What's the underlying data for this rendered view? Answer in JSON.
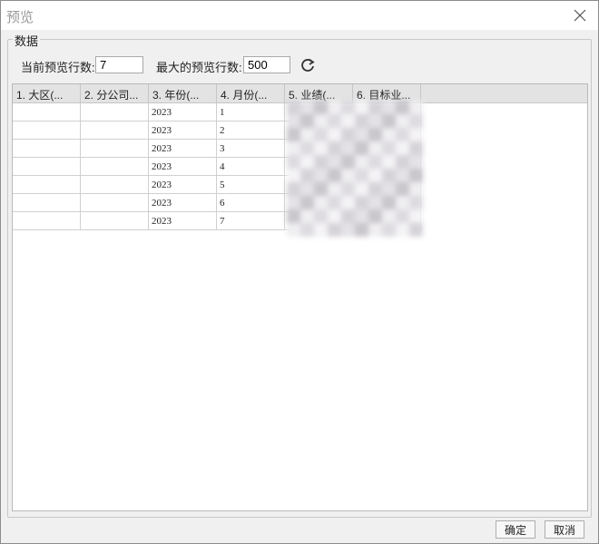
{
  "window": {
    "title": "预览"
  },
  "group": {
    "legend": "数据"
  },
  "controls": {
    "current_rows_label": "当前预览行数:",
    "current_rows_value": "7",
    "max_rows_label": "最大的预览行数:",
    "max_rows_value": "500"
  },
  "table": {
    "columns": [
      "1. 大区(...",
      "2. 分公司...",
      "3. 年份(...",
      "4. 月份(...",
      "5. 业绩(...",
      "6. 目标业..."
    ],
    "rows": [
      [
        "",
        "",
        "2023",
        "1",
        "",
        ""
      ],
      [
        "",
        "",
        "2023",
        "2",
        "",
        ""
      ],
      [
        "",
        "",
        "2023",
        "3",
        "",
        ""
      ],
      [
        "",
        "",
        "2023",
        "4",
        "",
        ""
      ],
      [
        "",
        "",
        "2023",
        "5",
        "",
        ""
      ],
      [
        "",
        "",
        "2023",
        "6",
        "",
        ""
      ],
      [
        "",
        "",
        "2023",
        "7",
        "",
        ""
      ]
    ]
  },
  "footer": {
    "ok_label": "确定",
    "cancel_label": "取消"
  },
  "icons": {
    "close": "close-icon",
    "refresh": "refresh-icon"
  }
}
